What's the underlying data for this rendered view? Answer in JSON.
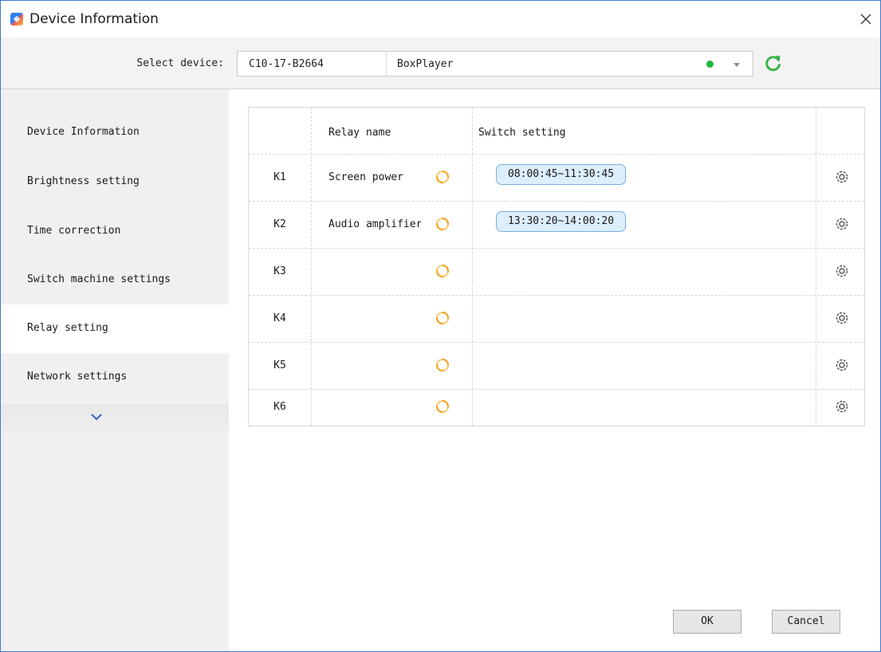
{
  "window": {
    "title": "Device Information"
  },
  "device_bar": {
    "label": "Select device:",
    "device_id": "C10-17-B2664",
    "device_name": "BoxPlayer",
    "status_color": "#1db83a",
    "refresh_icon": "refresh-icon"
  },
  "sidebar": {
    "items": [
      {
        "label": "Device Information",
        "active": false
      },
      {
        "label": "Brightness setting",
        "active": false
      },
      {
        "label": "Time correction",
        "active": false
      },
      {
        "label": "Switch machine settings",
        "active": false
      },
      {
        "label": "Relay setting",
        "active": true
      },
      {
        "label": "Network settings",
        "active": false
      }
    ],
    "more_icon": "chevron-down-icon"
  },
  "table": {
    "headers": {
      "id": "",
      "name": "Relay name",
      "switch": "Switch setting",
      "action": ""
    },
    "rows": [
      {
        "id": "K1",
        "name": "Screen power",
        "switch": "08:00:45~11:30:45"
      },
      {
        "id": "K2",
        "name": "Audio amplifier",
        "switch": "13:30:20~14:00:20"
      },
      {
        "id": "K3",
        "name": "",
        "switch": ""
      },
      {
        "id": "K4",
        "name": "",
        "switch": ""
      },
      {
        "id": "K5",
        "name": "",
        "switch": ""
      },
      {
        "id": "K6",
        "name": "",
        "switch": ""
      }
    ]
  },
  "footer": {
    "ok_label": "OK",
    "cancel_label": "Cancel"
  },
  "colors": {
    "accent": "#2f7ff0",
    "spinner": "#f5a623",
    "tag_bg": "#ddeefc",
    "tag_border": "#79aee0",
    "sidebar_bg": "#f0f0f0"
  }
}
